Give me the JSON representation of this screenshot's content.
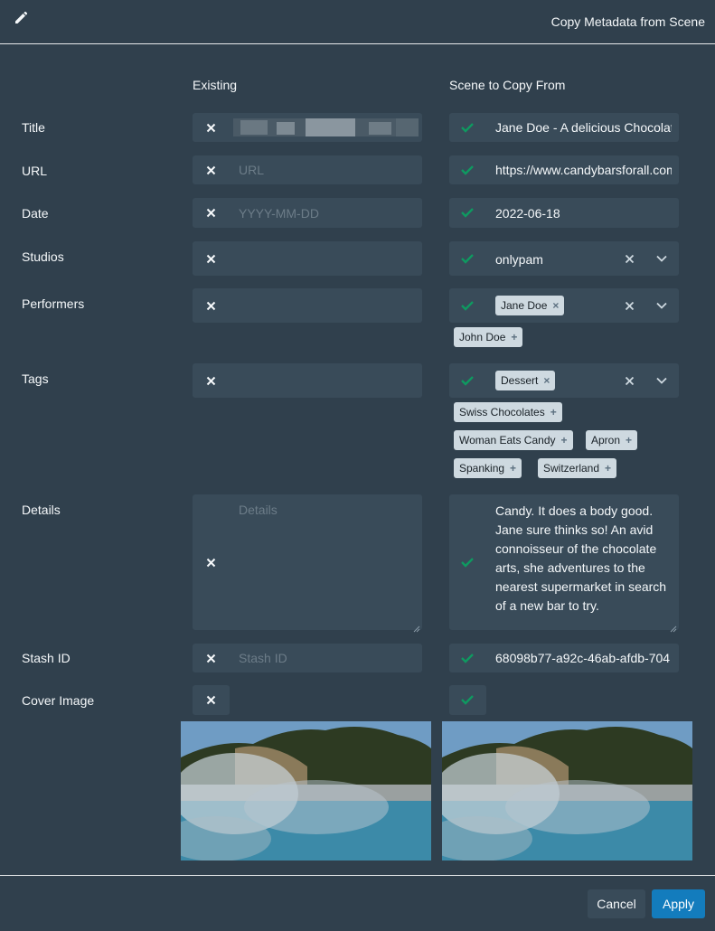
{
  "dialog": {
    "title": "Copy Metadata from Scene"
  },
  "columns": {
    "existing": "Existing",
    "source": "Scene to Copy From"
  },
  "rows": {
    "title": {
      "label": "Title",
      "existing_value": "",
      "source_value": "Jane Doe - A delicious Chocolate"
    },
    "url": {
      "label": "URL",
      "existing_placeholder": "URL",
      "source_value": "https://www.candybarsforall.com"
    },
    "date": {
      "label": "Date",
      "existing_placeholder": "YYYY-MM-DD",
      "source_value": "2022-06-18"
    },
    "studios": {
      "label": "Studios",
      "source_value": "onlypam"
    },
    "performers": {
      "label": "Performers",
      "selected": [
        "Jane Doe"
      ],
      "suggestions": [
        "John Doe"
      ]
    },
    "tags": {
      "label": "Tags",
      "selected": [
        "Dessert"
      ],
      "suggestions": [
        "Swiss Chocolates",
        "Woman Eats Candy",
        "Apron",
        "Spanking",
        "Switzerland"
      ]
    },
    "details": {
      "label": "Details",
      "existing_placeholder": "Details",
      "source_value": "Candy. It does a body good. Jane sure thinks so! An avid connoisseur of the chocolate arts, she adventures to the nearest supermarket in search of a new bar to try."
    },
    "stash_id": {
      "label": "Stash ID",
      "existing_placeholder": "Stash ID",
      "source_value": "68098b77-a92c-46ab-afdb-704"
    },
    "cover": {
      "label": "Cover Image"
    }
  },
  "footer": {
    "cancel": "Cancel",
    "apply": "Apply"
  },
  "colors": {
    "accent": "#137cbd",
    "check": "#0f9960",
    "bg": "#30404d",
    "field": "#394b59"
  }
}
